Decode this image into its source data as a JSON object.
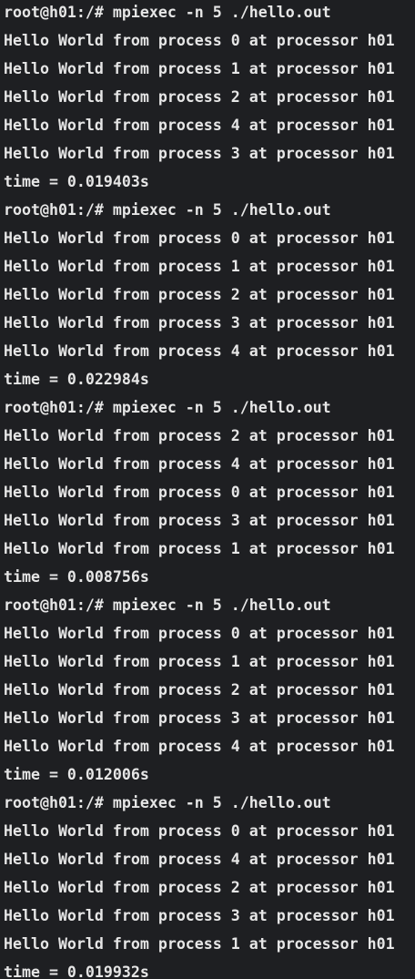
{
  "terminal": {
    "lines": [
      "root@h01:/# mpiexec -n 5 ./hello.out",
      "Hello World from process 0 at processor h01",
      "Hello World from process 1 at processor h01",
      "Hello World from process 2 at processor h01",
      "Hello World from process 4 at processor h01",
      "Hello World from process 3 at processor h01",
      "time = 0.019403s",
      "root@h01:/# mpiexec -n 5 ./hello.out",
      "Hello World from process 0 at processor h01",
      "Hello World from process 1 at processor h01",
      "Hello World from process 2 at processor h01",
      "Hello World from process 3 at processor h01",
      "Hello World from process 4 at processor h01",
      "time = 0.022984s",
      "root@h01:/# mpiexec -n 5 ./hello.out",
      "Hello World from process 2 at processor h01",
      "Hello World from process 4 at processor h01",
      "Hello World from process 0 at processor h01",
      "Hello World from process 3 at processor h01",
      "Hello World from process 1 at processor h01",
      "time = 0.008756s",
      "root@h01:/# mpiexec -n 5 ./hello.out",
      "Hello World from process 0 at processor h01",
      "Hello World from process 1 at processor h01",
      "Hello World from process 2 at processor h01",
      "Hello World from process 3 at processor h01",
      "Hello World from process 4 at processor h01",
      "time = 0.012006s",
      "root@h01:/# mpiexec -n 5 ./hello.out",
      "Hello World from process 0 at processor h01",
      "Hello World from process 4 at processor h01",
      "Hello World from process 2 at processor h01",
      "Hello World from process 3 at processor h01",
      "Hello World from process 1 at processor h01",
      "time = 0.019932s"
    ]
  },
  "colors": {
    "background": "#1e1f22",
    "foreground": "#e6e6e6"
  }
}
